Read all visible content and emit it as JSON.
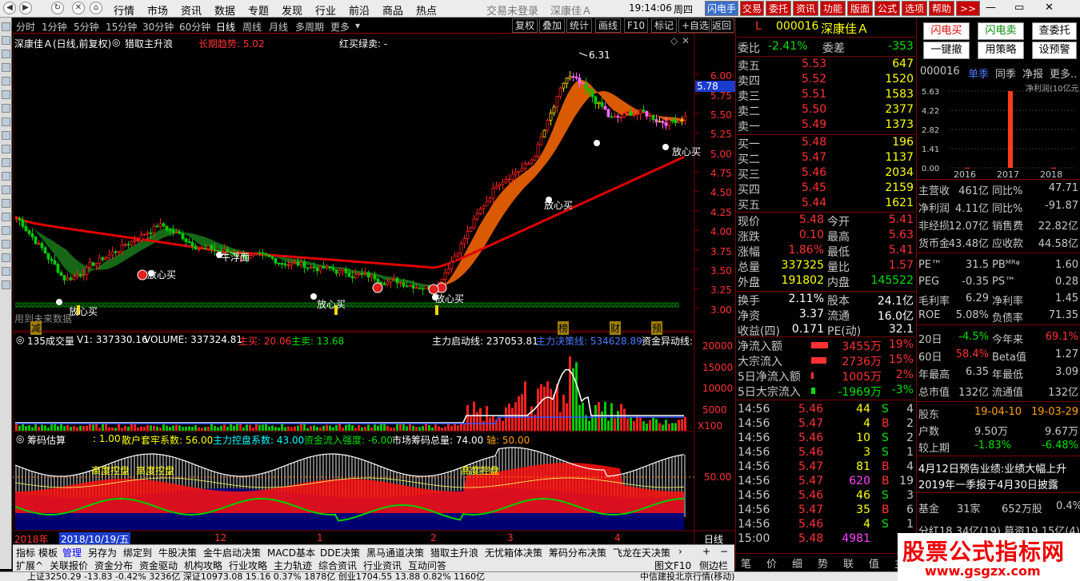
{
  "menu": {
    "items": [
      "行情",
      "市场",
      "资讯",
      "数据",
      "专题",
      "发现",
      "行业",
      "前沿",
      "商品",
      "热点"
    ],
    "login": "交易未登录",
    "stock_name": "深康佳Ａ",
    "time": "19:14:06",
    "weekday": "周四",
    "buttons": [
      "闪电手",
      "交易",
      "委托",
      "资讯",
      "功能",
      "版面",
      "公式",
      "选项",
      "帮助",
      ">>"
    ]
  },
  "tabs": {
    "periods": [
      "分时",
      "1分钟",
      "5分钟",
      "15分钟",
      "30分钟",
      "60分钟",
      "日线",
      "周线",
      "月线",
      "多周期",
      "更多"
    ],
    "active": "日线",
    "right": [
      "复权",
      "叠加",
      "统计",
      "画线",
      "F10",
      "标记",
      "+自选",
      "返回"
    ]
  },
  "main_chart": {
    "title": "深康佳Ａ(日线,前复权)",
    "indicator": "猎取主升浪",
    "trend_label": "长期趋势: 5.02",
    "signal_label": "红买绿卖: -",
    "high_label": "6.31",
    "current_price_tag": "5.78",
    "annotations": [
      "放心买",
      "放心买",
      "牛浮面",
      "放心买",
      "放心买",
      "放心买",
      "放心买",
      "用到未来数据"
    ],
    "markers": [
      "减",
      "榜",
      "财",
      "预"
    ],
    "y_ticks": [
      "6.00",
      "5.75",
      "5.50",
      "5.25",
      "5.00",
      "4.75",
      "4.50",
      "4.25",
      "4.00",
      "3.75",
      "3.50",
      "3.25",
      "3.00"
    ]
  },
  "volume_chart": {
    "header": "135成交量",
    "v1": "V1: 337330.16",
    "volume": "VOLUME: 337324.81",
    "zhumai": "主买: 20.06",
    "zhumai2": "主卖: 13.68",
    "qidong": "主力启动线: 237053.81",
    "juece": "主力决策线: 534628.89",
    "zijin": "资金异动线:",
    "y_ticks": [
      "20000",
      "15000",
      "10000",
      "5000",
      "X100"
    ]
  },
  "chip_chart": {
    "header": "筹码估算",
    "v1": ": 1.00",
    "sanhu": "散户套牢系数: 56.00",
    "zhuli": "主力控盘系数: 43.00",
    "zijin": "资金流入强度: -6.00",
    "shichang": "市场筹码总量: 74.00",
    "zhou": "轴: 50.00",
    "labels": [
      "高度控盘",
      "高度控盘",
      "高度控盘"
    ],
    "y_tick": "50.00"
  },
  "time_axis": {
    "labels": [
      "2018年",
      "2018/10/19/五",
      "12",
      "1",
      "2",
      "3",
      "4"
    ],
    "period": "日线"
  },
  "bottom_tabs": [
    "指标",
    "模板",
    "管理",
    "另存为",
    "绑定到",
    "牛股决策",
    "金牛启动决策",
    "MACD基本",
    "DDE决策",
    "黑马通道决策",
    "猎取主升浪",
    "无忧箱体决策",
    "筹码分布决策",
    "飞龙在天决策"
  ],
  "bottom_tabs2": [
    "扩展^",
    "关联报价",
    "资金分布",
    "资金驱动",
    "机构攻略",
    "行业攻略",
    "主力轨迹",
    "综合资讯",
    "行业资讯",
    "互动问答",
    "图文F10",
    "侧边栏"
  ],
  "quote": {
    "code": "000016",
    "name": "深康佳Ａ",
    "flag": "L",
    "weibi_label": "委比",
    "weibi": "-2.41%",
    "weicha_label": "委差",
    "weicha": "-353",
    "asks": [
      {
        "label": "卖五",
        "price": "5.53",
        "vol": "647"
      },
      {
        "label": "卖四",
        "price": "5.52",
        "vol": "1520"
      },
      {
        "label": "卖三",
        "price": "5.51",
        "vol": "1583"
      },
      {
        "label": "卖二",
        "price": "5.50",
        "vol": "2377"
      },
      {
        "label": "卖一",
        "price": "5.49",
        "vol": "1373"
      }
    ],
    "bids": [
      {
        "label": "买一",
        "price": "5.48",
        "vol": "196"
      },
      {
        "label": "买二",
        "price": "5.47",
        "vol": "1137"
      },
      {
        "label": "买三",
        "price": "5.46",
        "vol": "2034"
      },
      {
        "label": "买四",
        "price": "5.45",
        "vol": "2159"
      },
      {
        "label": "买五",
        "price": "5.44",
        "vol": "1621"
      }
    ],
    "stats": [
      {
        "l1": "现价",
        "v1": "5.48",
        "l2": "今开",
        "v2": "5.41"
      },
      {
        "l1": "涨跌",
        "v1": "0.10",
        "l2": "最高",
        "v2": "5.63"
      },
      {
        "l1": "涨幅",
        "v1": "1.86%",
        "l2": "最低",
        "v2": "5.41"
      },
      {
        "l1": "总量",
        "v1": "337325",
        "l2": "量比",
        "v2": "1.57"
      },
      {
        "l1": "外盘",
        "v1": "191802",
        "l2": "内盘",
        "v2": "145522"
      }
    ],
    "stats2": [
      {
        "l1": "换手",
        "v1": "2.11%",
        "l2": "股本",
        "v2": "24.1亿"
      },
      {
        "l1": "净资",
        "v1": "3.37",
        "l2": "流通",
        "v2": "16.0亿"
      },
      {
        "l1": "收益(四)",
        "v1": "0.171",
        "l2": "PE(动)",
        "v2": "32.1"
      }
    ],
    "flows": [
      {
        "label": "净流入额",
        "value": "3455万",
        "pct": "19%"
      },
      {
        "label": "大宗流入",
        "value": "2736万",
        "pct": "15%"
      },
      {
        "label": "5日净流入额",
        "value": "1005万",
        "pct": "2%"
      },
      {
        "label": "5日大宗流入",
        "value": "-1969万",
        "pct": "-3%"
      }
    ],
    "ticks": [
      {
        "time": "14:56",
        "price": "5.46",
        "vol": "44",
        "bs": "S",
        "n": "4"
      },
      {
        "time": "14:56",
        "price": "5.47",
        "vol": "4",
        "bs": "B",
        "n": "2"
      },
      {
        "time": "14:56",
        "price": "5.46",
        "vol": "10",
        "bs": "S",
        "n": "2"
      },
      {
        "time": "14:56",
        "price": "5.46",
        "vol": "3",
        "bs": "S",
        "n": "1"
      },
      {
        "time": "14:56",
        "price": "5.47",
        "vol": "81",
        "bs": "B",
        "n": "4"
      },
      {
        "time": "14:56",
        "price": "5.47",
        "vol": "620",
        "bs": "B",
        "n": "19"
      },
      {
        "time": "14:56",
        "price": "5.46",
        "vol": "46",
        "bs": "S",
        "n": "3"
      },
      {
        "time": "14:56",
        "price": "5.47",
        "vol": "35",
        "bs": "B",
        "n": "6"
      },
      {
        "time": "14:56",
        "price": "5.46",
        "vol": "4",
        "bs": "S",
        "n": "1"
      },
      {
        "time": "15:00",
        "price": "5.48",
        "vol": "4981",
        "bs": "",
        "n": "0"
      }
    ],
    "bottom_tabs": [
      "笔",
      "价",
      "细",
      "势",
      "联",
      "值",
      "主"
    ]
  },
  "right_panel": {
    "buttons": [
      "闪电买",
      "闪电卖",
      "查委托",
      "一键撤",
      "用策略",
      "设预警"
    ],
    "code": "000016",
    "tabs": [
      "单季",
      "同季",
      "净报",
      "更多.."
    ],
    "chart": {
      "title": "净利润(10亿元)",
      "y_ticks": [
        "5.63",
        "4.22",
        "2.82",
        "1.41",
        "0.00"
      ],
      "categories": [
        "2016",
        "2017",
        "2018"
      ]
    },
    "fin": [
      {
        "l1": "主营收",
        "v1": "461亿",
        "l2": "同比%",
        "v2": "47.71"
      },
      {
        "l1": "净利润",
        "v1": "4.11亿",
        "l2": "同比%",
        "v2": "-91.87"
      },
      {
        "l1": "非经损",
        "v1": "12.07亿",
        "l2": "销售费",
        "v2": "22.82亿"
      },
      {
        "l1": "货币金",
        "v1": "43.48亿",
        "l2": "应收款",
        "v2": "44.58亿"
      }
    ],
    "ratios": [
      {
        "l1": "PE™",
        "v1": "31.5",
        "l2": "PBᴹᴿᵠ",
        "v2": "1.60"
      },
      {
        "l1": "PEG",
        "v1": "-0.35",
        "l2": "PS™",
        "v2": "0.28"
      },
      {
        "l1": "毛利率",
        "v1": "6.29",
        "l2": "净利率",
        "v2": "1.45"
      },
      {
        "l1": "ROE",
        "v1": "5.08%",
        "l2": "负债率",
        "v2": "71.35"
      }
    ],
    "perf": [
      {
        "l1": "20日",
        "v1": "-4.5%",
        "l2": "今年来",
        "v2": "69.1%"
      },
      {
        "l1": "60日",
        "v1": "58.4%",
        "l2": "Beta值",
        "v2": "1.27"
      },
      {
        "l1": "年最高",
        "v1": "6.35",
        "l2": "年最低",
        "v2": "3.09"
      },
      {
        "l1": "总市值",
        "v1": "132亿",
        "l2": "流通值",
        "v2": "132亿"
      }
    ],
    "holders": [
      {
        "l1": "股东",
        "v1": "19-04-10",
        "v2": "19-03-29"
      },
      {
        "l1": "户数",
        "v1": "9.50万",
        "v2": "9.67万"
      },
      {
        "l1": "较上期",
        "v1": "-1.83%",
        "v2": "-6.48%"
      }
    ],
    "news": [
      "4月12日预告业绩:业绩大幅上升",
      "2019年一季报于4月30日披露"
    ],
    "fund": {
      "label": "基金",
      "count": "31家",
      "shares": "652万股",
      "pct": "0.4%"
    },
    "cut": "分红18.34亿(19) 募资19.15亿(4)"
  },
  "status": {
    "text": "上证3250.29  -13.83  -0.42%  3236亿  深证10973.08  15.16  0.37%  1878亿  创业1704.55  13.88  0.82%  1160亿",
    "news": "中信建投北京行情(移动)"
  },
  "watermark": {
    "line1": "股票公式指标网",
    "line2": "www.gsgzx.com"
  }
}
